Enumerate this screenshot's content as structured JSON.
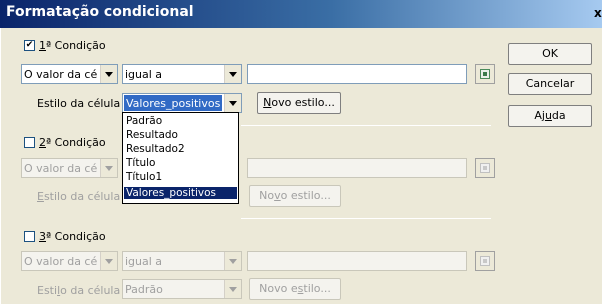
{
  "window": {
    "title": "Formatação condicional",
    "close_glyph": "x"
  },
  "buttons": {
    "ok": "OK",
    "cancel": "Cancelar",
    "help_before": "Aj",
    "help_mnemonic": "u",
    "help_after": "da"
  },
  "conditions": [
    {
      "checked": true,
      "check_glyph": "✔",
      "label_mnemonic": "1",
      "label_rest": "ª Condição",
      "source": "O valor da célu",
      "operator": "igual a",
      "value": "",
      "style_label": "Estilo da célula",
      "style_value": "Valores_positivos",
      "new_style_mnemonic": "N",
      "new_style_rest": "ovo estilo..."
    },
    {
      "checked": false,
      "label_mnemonic": "2",
      "label_rest": "ª Condição",
      "source": "O valor da célu",
      "operator": "",
      "value": "",
      "style_label_mnemonic": "E",
      "style_label_rest": "stilo da célula",
      "new_style_before": "No",
      "new_style_mnemonic": "v",
      "new_style_after": "o estilo..."
    },
    {
      "checked": false,
      "label_mnemonic": "3",
      "label_rest": "ª Condição",
      "source": "O valor da célu",
      "operator": "igual a",
      "value": "",
      "style_label_before": "Esti",
      "style_label_mnemonic": "l",
      "style_label_after": "o da célula",
      "style_value": "Padrão",
      "new_style_before": "Novo e",
      "new_style_mnemonic": "s",
      "new_style_after": "tilo..."
    }
  ],
  "style_dropdown": {
    "options": [
      "Padrão",
      "Resultado",
      "Resultado2",
      "Título",
      "Título1",
      "Valores_positivos"
    ],
    "selected": "Valores_positivos"
  },
  "colors": {
    "selection": "#0a246a",
    "title_gradient_start": "#0a246a",
    "dialog_bg": "#ece9d8"
  }
}
